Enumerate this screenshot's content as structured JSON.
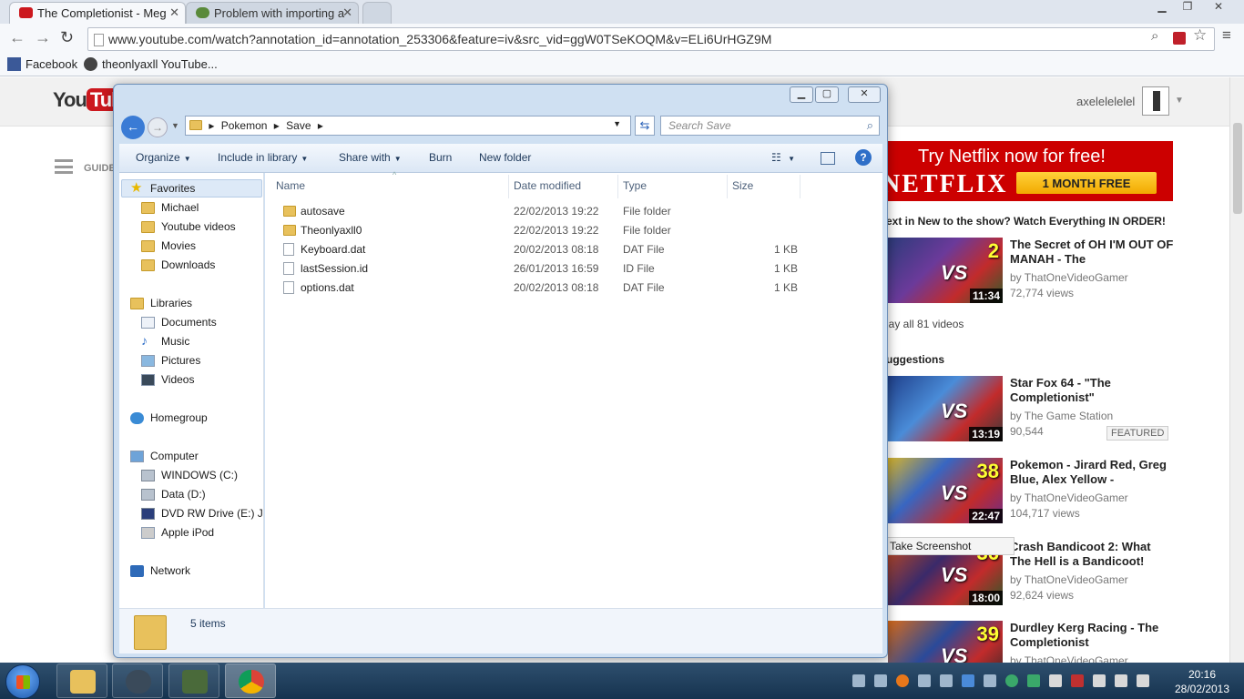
{
  "browser": {
    "tabs": [
      {
        "label": "The Completionist - Meg",
        "close": "✕"
      },
      {
        "label": "Problem with importing a",
        "close": "✕"
      }
    ],
    "address": "www.youtube.com/watch?annotation_id=annotation_253306&feature=iv&src_vid=ggW0TSeKOQM&v=ELi6UrHGZ9M",
    "bookmarks": [
      "Facebook",
      "theonlyaxll YouTube..."
    ]
  },
  "youtube": {
    "logo_you": "You",
    "logo_tube": "Tube",
    "username": "axelelelelel",
    "guide": "GUIDE",
    "ad": {
      "headline": "Try Netflix now for free!",
      "brand": "NETFLIX",
      "button": "1 MONTH FREE"
    },
    "playlist_title": "ext in New to the show? Watch Everything IN ORDER!",
    "play_all": "lay all 81 videos",
    "suggestions": "uggestions",
    "videos": [
      {
        "title": "The Secret of OH I'M OUT OF MANAH - The",
        "by": "by ThatOneVideoGamer",
        "views": "72,774 views",
        "duration": "11:34",
        "ep": "2"
      },
      {
        "title": "Star Fox 64 - \"The Completionist\"",
        "by": "by The Game Station",
        "views": "90,544",
        "duration": "13:19",
        "ep": "",
        "badge": "FEATURED"
      },
      {
        "title": "Pokemon - Jirard Red, Greg Blue, Alex Yellow -",
        "by": "by ThatOneVideoGamer",
        "views": "104,717 views",
        "duration": "22:47",
        "ep": "38"
      },
      {
        "title": "Crash Bandicoot 2: What The Hell is a Bandicoot!",
        "by": "by ThatOneVideoGamer",
        "views": "92,624 views",
        "duration": "18:00",
        "ep": "36"
      },
      {
        "title": "Durdley Kerg Racing - The Completionist",
        "by": "by ThatOneVideoGamer",
        "views": "",
        "duration": "",
        "ep": "39"
      }
    ],
    "vs_label": "VS",
    "context_menu": "Take Screenshot"
  },
  "explorer": {
    "path": [
      "Pokemon",
      "Save"
    ],
    "search_placeholder": "Search Save",
    "commands": [
      "Organize",
      "Include in library",
      "Share with",
      "Burn",
      "New folder"
    ],
    "nav": {
      "favorites": "Favorites",
      "favorite_items": [
        "Michael",
        "Youtube videos",
        "Movies",
        "Downloads"
      ],
      "libraries": "Libraries",
      "library_items": [
        "Documents",
        "Music",
        "Pictures",
        "Videos"
      ],
      "homegroup": "Homegroup",
      "computer": "Computer",
      "computer_items": [
        "WINDOWS (C:)",
        "Data (D:)",
        "DVD RW Drive (E:) JE",
        "Apple iPod"
      ],
      "network": "Network"
    },
    "columns": [
      "Name",
      "Date modified",
      "Type",
      "Size"
    ],
    "files": [
      {
        "name": "autosave",
        "date": "22/02/2013 19:22",
        "type": "File folder",
        "size": ""
      },
      {
        "name": "Theonlyaxll0",
        "date": "22/02/2013 19:22",
        "type": "File folder",
        "size": ""
      },
      {
        "name": "Keyboard.dat",
        "date": "20/02/2013 08:18",
        "type": "DAT File",
        "size": "1 KB"
      },
      {
        "name": "lastSession.id",
        "date": "26/01/2013 16:59",
        "type": "ID File",
        "size": "1 KB"
      },
      {
        "name": "options.dat",
        "date": "20/02/2013 08:18",
        "type": "DAT File",
        "size": "1 KB"
      }
    ],
    "status": "5 items"
  },
  "taskbar": {
    "time": "20:16",
    "date": "28/02/2013",
    "apps": [
      "explorer-icon",
      "steam-icon",
      "shield-app-icon",
      "chrome-icon"
    ]
  },
  "colors": {
    "youtube_red": "#cc181e",
    "netflix_red": "#cc0000",
    "explorer_frame": "#cfe0f2",
    "taskbar": "#16334f"
  }
}
